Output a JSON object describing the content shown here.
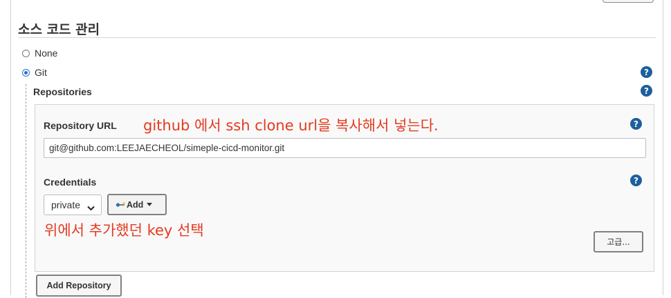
{
  "section": {
    "title": "소스 코드 관리"
  },
  "scm_options": [
    {
      "label": "None",
      "selected": false
    },
    {
      "label": "Git",
      "selected": true
    }
  ],
  "help_icon": "?",
  "repositories": {
    "label": "Repositories",
    "url_label": "Repository URL",
    "url_annotation": "github 에서 ssh clone url을 복사해서 넣는다.",
    "url_value": "git@github.com:LEEJAECHEOL/simeple-cicd-monitor.git",
    "credentials_label": "Credentials",
    "credentials_selected": "private",
    "add_button": "Add",
    "credentials_annotation": "위에서 추가했던 key 선택",
    "advanced_button": "고급...",
    "add_repository_button": "Add Repository"
  },
  "colors": {
    "annotation": "#e43a20",
    "help_icon": "#1d5f9c",
    "radio_selected": "#1e6fd9"
  }
}
